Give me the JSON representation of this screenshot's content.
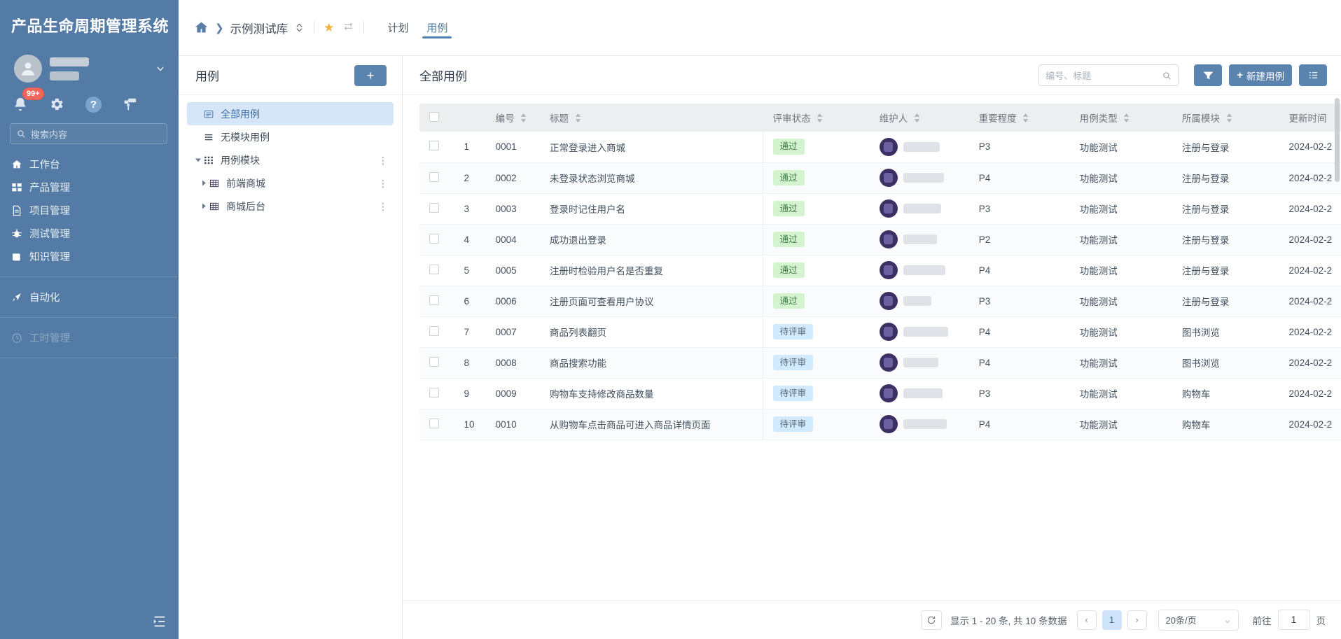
{
  "sidebar": {
    "brand": "产品生命周期管理系统",
    "notification_badge": "99+",
    "search_placeholder": "搜索内容",
    "nav": [
      {
        "label": "工作台",
        "icon": "home-icon"
      },
      {
        "label": "产品管理",
        "icon": "grid-icon"
      },
      {
        "label": "项目管理",
        "icon": "document-icon"
      },
      {
        "label": "测试管理",
        "icon": "bug-icon"
      },
      {
        "label": "知识管理",
        "icon": "book-icon"
      }
    ],
    "nav2": [
      {
        "label": "自动化",
        "icon": "rocket-icon"
      }
    ],
    "nav3": [
      {
        "label": "工时管理",
        "icon": "clock-icon",
        "disabled": true
      }
    ]
  },
  "topbar": {
    "breadcrumb_repo": "示例测试库",
    "tabs": [
      {
        "label": "计划",
        "active": false
      },
      {
        "label": "用例",
        "active": true
      }
    ]
  },
  "tree": {
    "title": "用例",
    "add_label": "+",
    "items": [
      {
        "label": "全部用例",
        "icon": "list-box-icon",
        "selected": true,
        "level": 0,
        "expander": "none",
        "menu": false
      },
      {
        "label": "无模块用例",
        "icon": "lines-icon",
        "selected": false,
        "level": 0,
        "expander": "none",
        "menu": false
      },
      {
        "label": "用例模块",
        "icon": "dots-grid-icon",
        "selected": false,
        "level": 0,
        "expander": "open",
        "menu": true
      },
      {
        "label": "前端商城",
        "icon": "table-icon",
        "selected": false,
        "level": 1,
        "expander": "closed",
        "menu": true
      },
      {
        "label": "商城后台",
        "icon": "table-icon",
        "selected": false,
        "level": 1,
        "expander": "closed",
        "menu": true
      }
    ]
  },
  "content": {
    "title": "全部用例",
    "search_placeholder": "编号、标题",
    "filter_label": "filter-icon",
    "new_case_label": "新建用例",
    "columns_label": "columns-icon",
    "columns": [
      {
        "key": "check",
        "label": "",
        "sortable": false
      },
      {
        "key": "index",
        "label": "",
        "sortable": false
      },
      {
        "key": "code",
        "label": "编号",
        "sortable": true
      },
      {
        "key": "title",
        "label": "标题",
        "sortable": true
      },
      {
        "key": "review",
        "label": "评审状态",
        "sortable": true
      },
      {
        "key": "owner",
        "label": "维护人",
        "sortable": true
      },
      {
        "key": "priority",
        "label": "重要程度",
        "sortable": true
      },
      {
        "key": "type",
        "label": "用例类型",
        "sortable": true
      },
      {
        "key": "module",
        "label": "所属模块",
        "sortable": true
      },
      {
        "key": "updated",
        "label": "更新时间",
        "sortable": false
      }
    ],
    "rows": [
      {
        "index": "1",
        "code": "0001",
        "title": "正常登录进入商城",
        "review": "通过",
        "review_state": "pass",
        "priority": "P3",
        "type": "功能测试",
        "module": "注册与登录",
        "updated": "2024-02-2"
      },
      {
        "index": "2",
        "code": "0002",
        "title": "未登录状态浏览商城",
        "review": "通过",
        "review_state": "pass",
        "priority": "P4",
        "type": "功能测试",
        "module": "注册与登录",
        "updated": "2024-02-2"
      },
      {
        "index": "3",
        "code": "0003",
        "title": "登录时记住用户名",
        "review": "通过",
        "review_state": "pass",
        "priority": "P3",
        "type": "功能测试",
        "module": "注册与登录",
        "updated": "2024-02-2"
      },
      {
        "index": "4",
        "code": "0004",
        "title": "成功退出登录",
        "review": "通过",
        "review_state": "pass",
        "priority": "P2",
        "type": "功能测试",
        "module": "注册与登录",
        "updated": "2024-02-2"
      },
      {
        "index": "5",
        "code": "0005",
        "title": "注册时检验用户名是否重复",
        "review": "通过",
        "review_state": "pass",
        "priority": "P4",
        "type": "功能测试",
        "module": "注册与登录",
        "updated": "2024-02-2"
      },
      {
        "index": "6",
        "code": "0006",
        "title": "注册页面可查看用户协议",
        "review": "通过",
        "review_state": "pass",
        "priority": "P3",
        "type": "功能测试",
        "module": "注册与登录",
        "updated": "2024-02-2"
      },
      {
        "index": "7",
        "code": "0007",
        "title": "商品列表翻页",
        "review": "待评审",
        "review_state": "wait",
        "priority": "P4",
        "type": "功能测试",
        "module": "图书浏览",
        "updated": "2024-02-2"
      },
      {
        "index": "8",
        "code": "0008",
        "title": "商品搜索功能",
        "review": "待评审",
        "review_state": "wait",
        "priority": "P4",
        "type": "功能测试",
        "module": "图书浏览",
        "updated": "2024-02-2"
      },
      {
        "index": "9",
        "code": "0009",
        "title": "购物车支持修改商品数量",
        "review": "待评审",
        "review_state": "wait",
        "priority": "P3",
        "type": "功能测试",
        "module": "购物车",
        "updated": "2024-02-2"
      },
      {
        "index": "10",
        "code": "0010",
        "title": "从购物车点击商品可进入商品详情页面",
        "review": "待评审",
        "review_state": "wait",
        "priority": "P4",
        "type": "功能测试",
        "module": "购物车",
        "updated": "2024-02-2"
      }
    ]
  },
  "pagination": {
    "summary": "显示 1 - 20 条, 共 10 条数据",
    "prev": "‹",
    "current_page": "1",
    "next": "›",
    "page_size": "20条/页",
    "goto_label": "前往",
    "goto_value": "1",
    "goto_unit": "页"
  },
  "colors": {
    "sidebar_bg": "#547ba5",
    "accent": "#5a83ae",
    "tag_pass_bg": "#d4f4cf",
    "tag_wait_bg": "#d2eafd",
    "selected_tree_bg": "#d6e6f8",
    "badge_red": "#f2675c",
    "star_gold": "#f3b13d"
  }
}
